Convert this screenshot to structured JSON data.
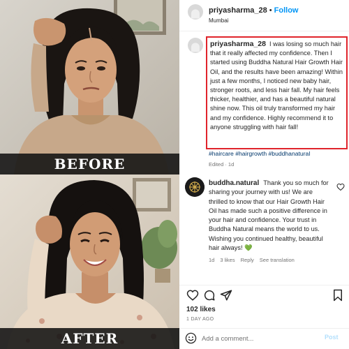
{
  "photos": {
    "before_label": "BEFORE",
    "after_label": "AFTER"
  },
  "header": {
    "username": "priyasharma_28",
    "separator": "•",
    "follow_label": "Follow",
    "location": "Mumbai"
  },
  "caption": {
    "username": "priyasharma_28",
    "text": "I was losing so much hair that it really affected my confidence. Then I started using Buddha Natural Hair Growth Hair Oil, and the results have been amazing! Within just a few months, I noticed new baby hair, stronger roots, and less hair fall. My hair feels thicker, healthier, and has a beautiful natural shine now. This oil truly transformed my hair and my confidence. Highly recommend it to anyone struggling with hair fall!",
    "hashtags": "#haircare #hairgrowth #buddhanatural",
    "edited": "Edited · 1d"
  },
  "reply": {
    "username": "buddha.natural",
    "text": "Thank you so much for sharing your journey with us! We are thrilled to know that our Hair Growth Hair Oil has made such a positive difference in your hair and confidence. Your trust in Buddha Natural means the world to us. Wishing you continued healthy, beautiful hair always! 💚",
    "age": "1d",
    "likes": "3 likes",
    "reply_label": "Reply",
    "translation_label": "See translation"
  },
  "post": {
    "likes": "102 likes",
    "time_ago": "1 DAY AGO"
  },
  "comment": {
    "placeholder": "Add a comment...",
    "post_label": "Post"
  },
  "icons": {
    "header_avatar": "user-avatar-icon",
    "like": "heart-icon",
    "comment": "comment-bubble-icon",
    "share": "paper-plane-icon",
    "save": "bookmark-icon",
    "emoji": "smiley-icon"
  },
  "colors": {
    "follow": "#0095f6",
    "highlight_border": "#e0242b",
    "hashtag": "#00376b",
    "muted": "#737373",
    "post_button": "#b2dffc"
  }
}
